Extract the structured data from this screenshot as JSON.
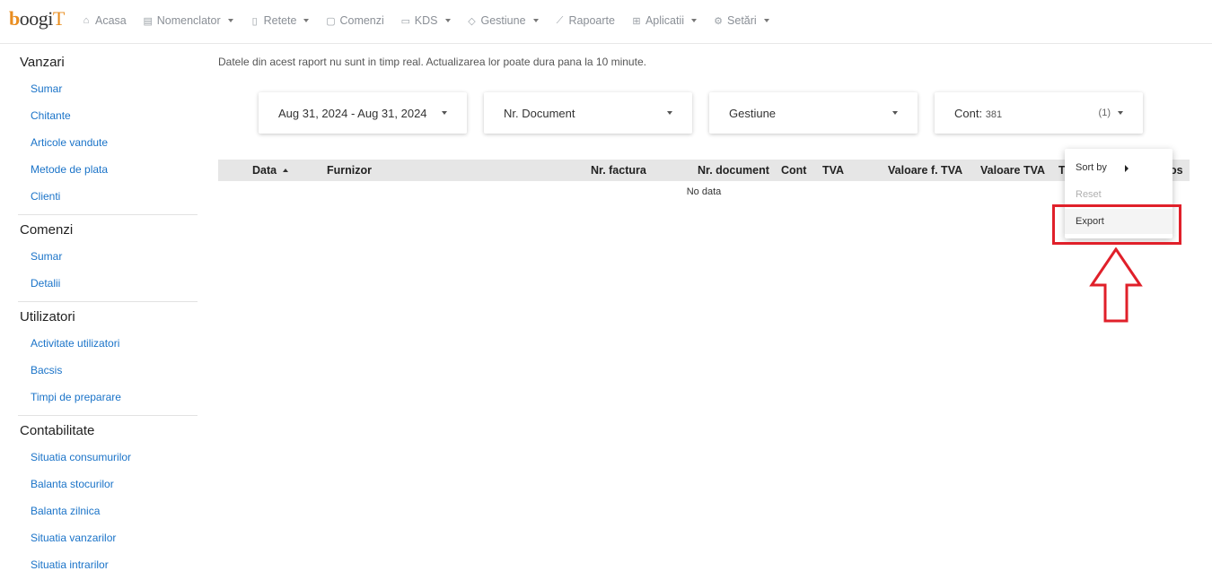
{
  "nav": {
    "logo_text": "boogiT",
    "items": [
      {
        "label": "Acasa",
        "icon": "home-icon",
        "dropdown": false
      },
      {
        "label": "Nomenclator",
        "icon": "document-list-icon",
        "dropdown": true
      },
      {
        "label": "Retete",
        "icon": "recipe-icon",
        "dropdown": true
      },
      {
        "label": "Comenzi",
        "icon": "bag-icon",
        "dropdown": false
      },
      {
        "label": "KDS",
        "icon": "monitor-icon",
        "dropdown": true
      },
      {
        "label": "Gestiune",
        "icon": "box-icon",
        "dropdown": true
      },
      {
        "label": "Rapoarte",
        "icon": "chart-icon",
        "dropdown": false
      },
      {
        "label": "Aplicatii",
        "icon": "grid-icon",
        "dropdown": true
      },
      {
        "label": "Setări",
        "icon": "gear-icon",
        "dropdown": true
      }
    ]
  },
  "sidebar": {
    "sections": [
      {
        "title": "Vanzari",
        "items": [
          "Sumar",
          "Chitante",
          "Articole vandute",
          "Metode de plata",
          "Clienti"
        ]
      },
      {
        "title": "Comenzi",
        "items": [
          "Sumar",
          "Detalii"
        ]
      },
      {
        "title": "Utilizatori",
        "items": [
          "Activitate utilizatori",
          "Bacsis",
          "Timpi de preparare"
        ]
      },
      {
        "title": "Contabilitate",
        "items": [
          "Situatia consumurilor",
          "Balanta stocurilor",
          "Balanta zilnica",
          "Situatia vanzarilor",
          "Situatia intrarilor"
        ]
      }
    ]
  },
  "main": {
    "notice": "Datele din acest raport nu sunt in timp real. Actualizarea lor poate dura pana la 10 minute.",
    "filters": {
      "date_range": "Aug 31, 2024 - Aug 31, 2024",
      "document": "Nr. Document",
      "gestiune": "Gestiune",
      "cont_label": "Cont:",
      "cont_value": "381",
      "cont_count": "(1)"
    },
    "table": {
      "columns": [
        "Data",
        "Furnizor",
        "Nr. factura",
        "Nr. document",
        "Cont",
        "TVA",
        "Valoare f. TVA",
        "Valoare TVA",
        "T",
        "os"
      ],
      "empty_text": "No data"
    },
    "menu": {
      "sort_by": "Sort by",
      "reset": "Reset",
      "export": "Export"
    }
  },
  "colors": {
    "link": "#1a73c8",
    "highlight": "#e0202a",
    "header_bg": "#e6e6e6",
    "logo_accent": "#e98d1f"
  }
}
